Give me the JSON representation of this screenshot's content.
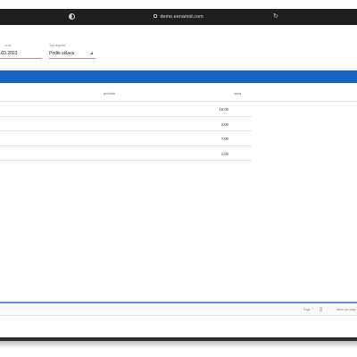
{
  "browser": {
    "url": "demo.eenamid.com"
  },
  "filters": {
    "date": {
      "label": "ci do",
      "value": ".03.2023"
    },
    "report_type": {
      "label": "Typ reportu",
      "value": "Podle sklavu"
    }
  },
  "table": {
    "headers": {
      "product": "produkt",
      "count": "cena"
    },
    "rows": [
      {
        "value": "15.00"
      },
      {
        "value": "2.00"
      },
      {
        "value": "7.00"
      },
      {
        "value": "1.00"
      }
    ]
  },
  "footer": {
    "page_label": "Page",
    "page_current": "1",
    "page_next": "1",
    "items_label": "Items per page"
  },
  "colors": {
    "accent": "#1565c0",
    "browser_bar": "#1f1f21"
  }
}
